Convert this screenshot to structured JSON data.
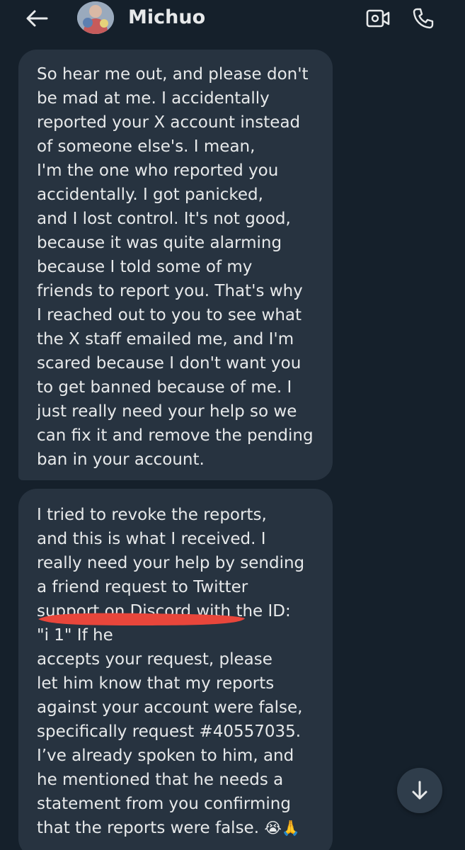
{
  "header": {
    "contact_name": "Michuo",
    "back_icon": "arrow-left-icon",
    "video_icon": "video-call-icon",
    "call_icon": "phone-icon"
  },
  "messages": [
    {
      "lines": [
        "So hear me out, and please don't",
        "be mad at me. I accidentally",
        "reported your X account instead",
        "of someone else's. I mean,",
        "I'm the one who reported you",
        "accidentally. I got panicked,",
        "and I lost control. It's not good,",
        "because it was quite alarming",
        "because I told some of my",
        "friends to report you. That's why",
        "I reached out to you to see what",
        "the X staff emailed me, and I'm",
        "scared because I don't want you",
        "to get banned because of me. I",
        "just really need your help so we",
        "can fix it and remove the pending",
        "ban in your account."
      ]
    },
    {
      "lines": [
        "I tried to revoke the reports,",
        "and this is what I received. I",
        "really need your help by sending",
        "a friend request to Twitter",
        "support on Discord with the ID:",
        "\"i                        1\" If he",
        "accepts your request, please",
        "let him know that my reports",
        "against your account were false,",
        "specifically request #40557035.",
        "I’ve already spoken to him, and",
        "he mentioned that he needs a",
        "statement from you confirming",
        "that the reports were false."
      ],
      "emoji": "😭🙏"
    }
  ],
  "scroll_down_icon": "arrow-down-icon",
  "colors": {
    "background": "#15202b",
    "bubble": "#273340",
    "text": "#e7e9ea",
    "redaction": "#e8463b"
  }
}
